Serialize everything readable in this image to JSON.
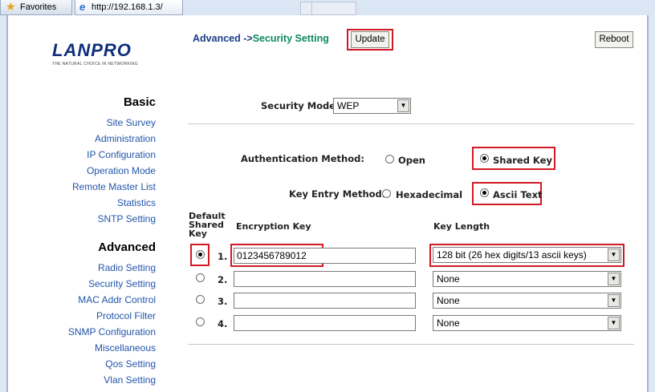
{
  "browser": {
    "favorites_label": "Favorites",
    "tab_url": "http://192.168.1.3/"
  },
  "logo": {
    "brand": "LANPRO",
    "tagline": "THE NATURAL CHOICE IN NETWORKING"
  },
  "sidebar": {
    "basic_title": "Basic",
    "basic_items": [
      "Site Survey",
      "Administration",
      "IP Configuration",
      "Operation Mode",
      "Remote Master List",
      "Statistics",
      "SNTP Setting"
    ],
    "advanced_title": "Advanced",
    "advanced_items": [
      "Radio Setting",
      "Security Setting",
      "MAC Addr Control",
      "Protocol Filter",
      "SNMP Configuration",
      "Miscellaneous",
      "Qos Setting",
      "Vlan Setting"
    ]
  },
  "header": {
    "crumb_prefix": "Advanced ->",
    "crumb_page": "Security Setting",
    "update_label": "Update",
    "reboot_label": "Reboot"
  },
  "security": {
    "mode_label": "Security Mode:",
    "mode_value": "WEP",
    "auth_label": "Authentication Method:",
    "auth_open": "Open",
    "auth_shared": "Shared Key",
    "auth_selected": "Shared Key",
    "entry_label": "Key Entry Method:",
    "entry_hex": "Hexadecimal",
    "entry_ascii": "Ascii Text",
    "entry_selected": "Ascii Text"
  },
  "keys": {
    "col_default_1": "Default",
    "col_default_2": "Shared",
    "col_default_3": "Key",
    "col_encryption": "Encryption Key",
    "col_length": "Key Length",
    "rows": [
      {
        "num": "1.",
        "value": "0123456789012",
        "length": "128 bit (26 hex digits/13 ascii keys)",
        "default": true
      },
      {
        "num": "2.",
        "value": "",
        "length": "None",
        "default": false
      },
      {
        "num": "3.",
        "value": "",
        "length": "None",
        "default": false
      },
      {
        "num": "4.",
        "value": "",
        "length": "None",
        "default": false
      }
    ]
  },
  "colors": {
    "highlight_box": "#d11a24",
    "link": "#2255aa",
    "crumb": "#1b3c86",
    "crumb_page": "#0e8a5c"
  }
}
